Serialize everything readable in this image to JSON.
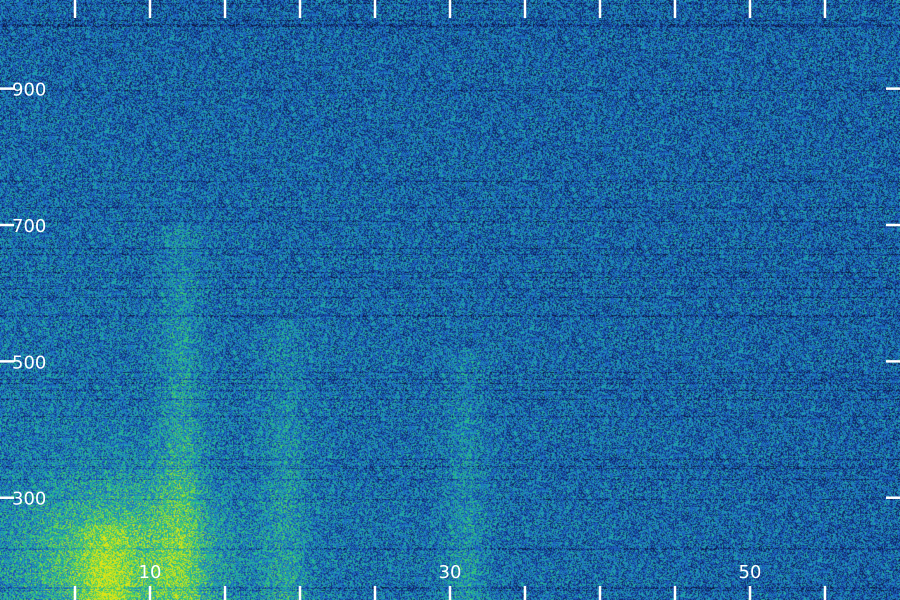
{
  "chart_data": {
    "type": "heatmap",
    "title": "",
    "xlabel": "",
    "ylabel": "",
    "xlim": [
      0,
      60
    ],
    "ylim": [
      150,
      1030
    ],
    "x_tick_labels": [
      {
        "value": 10,
        "label": "10"
      },
      {
        "value": 30,
        "label": "30"
      },
      {
        "value": 50,
        "label": "50"
      }
    ],
    "x_ticks": [
      0,
      5,
      10,
      15,
      20,
      25,
      30,
      35,
      40,
      45,
      50,
      55,
      60
    ],
    "y_tick_labels": [
      {
        "value": 300,
        "label": "300"
      },
      {
        "value": 500,
        "label": "500"
      },
      {
        "value": 700,
        "label": "700"
      },
      {
        "value": 900,
        "label": "900"
      }
    ],
    "y_ticks": [
      300,
      500,
      700,
      900
    ],
    "colormap": [
      "#0a1436",
      "#123a8c",
      "#1f64c8",
      "#1fa0b4",
      "#2ec87a",
      "#9adc32",
      "#e6e614"
    ],
    "grid": false,
    "energy_features": [
      {
        "x": 7,
        "y_from": 150,
        "y_to": 260,
        "intensity": 1.0
      },
      {
        "x": 12,
        "y_from": 150,
        "y_to": 700,
        "intensity": 0.75
      },
      {
        "x": 19,
        "y_from": 150,
        "y_to": 560,
        "intensity": 0.55
      },
      {
        "x": 31,
        "y_from": 150,
        "y_to": 520,
        "intensity": 0.5
      }
    ]
  }
}
